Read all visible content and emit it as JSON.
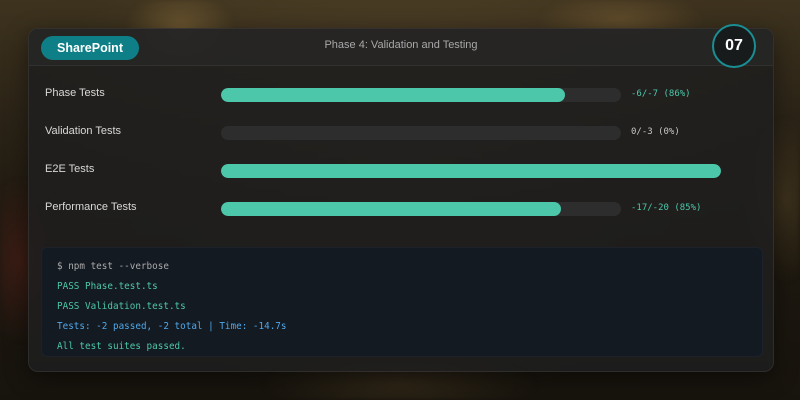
{
  "header": {
    "brand": "SharePoint",
    "title": "Phase 4: Validation and Testing",
    "step": "07"
  },
  "tests": [
    {
      "label": "Phase Tests",
      "value": "-6/-7 (86%)",
      "progress": 0.86,
      "value_style": "accent"
    },
    {
      "label": "Validation Tests",
      "value": "0/-3 (0%)",
      "progress": 0.0,
      "value_style": "muted"
    },
    {
      "label": "E2E Tests",
      "value": "",
      "progress": 1.0,
      "value_style": "accent"
    },
    {
      "label": "Performance Tests",
      "value": "-17/-20 (85%)",
      "progress": 0.85,
      "value_style": "accent"
    }
  ],
  "terminal": {
    "lines": [
      {
        "text": "$ npm test --verbose",
        "kind": "cmd"
      },
      {
        "text": "PASS Phase.test.ts",
        "kind": "pass"
      },
      {
        "text": "PASS Validation.test.ts",
        "kind": "pass"
      },
      {
        "text": "Tests: -2 passed, -2 total | Time: -14.7s",
        "kind": "info"
      },
      {
        "text": "All test suites passed.",
        "kind": "ok"
      }
    ]
  },
  "colors": {
    "brand": "#0e7f86",
    "accent": "#4cc7a9",
    "info": "#4fa7e8",
    "panel": "#1e1e1e",
    "terminal_bg": "#141a22"
  }
}
